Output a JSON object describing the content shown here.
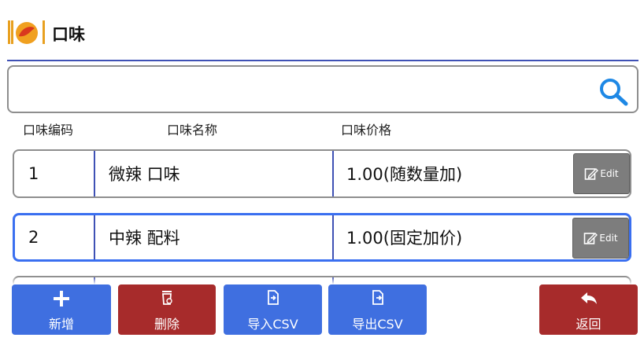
{
  "header": {
    "title": "口味",
    "logo_icon": "chili-plate-logo-icon"
  },
  "search": {
    "value": "",
    "icon": "search-icon"
  },
  "columns": [
    "口味编码",
    "口味名称",
    "口味价格"
  ],
  "rows": [
    {
      "code": "1",
      "name": "微辣 口味",
      "price": "1.00(随数量加)",
      "edit_label": "Edit",
      "selected": false
    },
    {
      "code": "2",
      "name": "中辣 配料",
      "price": "1.00(固定加价)",
      "edit_label": "Edit",
      "selected": true
    }
  ],
  "toolbar": {
    "add_label": "新增",
    "delete_label": "删除",
    "import_label": "导入CSV",
    "export_label": "导出CSV",
    "back_label": "返回"
  },
  "colors": {
    "accent_blue": "#3f6fe0",
    "danger_red": "#a72b2b",
    "divider": "#3f51b5",
    "selected_border": "#3a6ff0"
  }
}
